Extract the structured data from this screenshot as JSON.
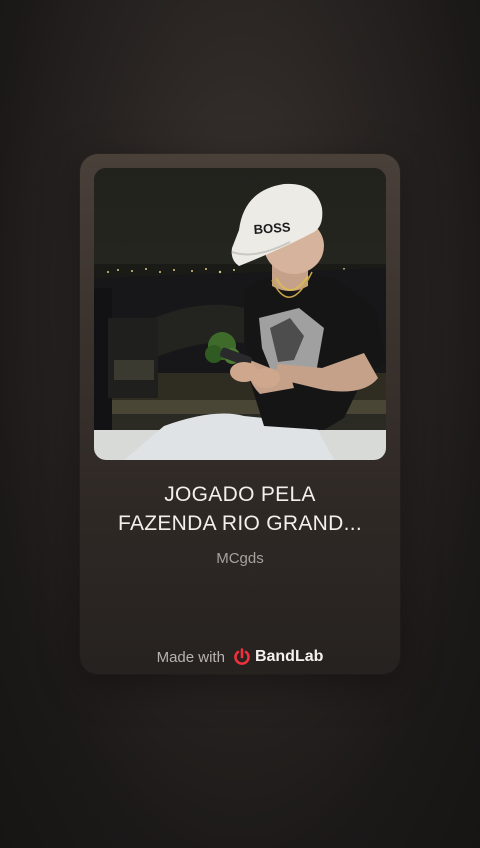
{
  "track": {
    "title_line1": "JOGADO PELA",
    "title_line2": "FAZENDA RIO GRAND...",
    "artist": "MCgds",
    "cap_text": "BOSS"
  },
  "footer": {
    "made_with": "Made with",
    "brand": "BandLab"
  },
  "colors": {
    "brand_red": "#f0303a",
    "background": "#1b1918",
    "card": "#3a322d"
  },
  "icons": {
    "brand": "bandlab-logo-icon"
  }
}
